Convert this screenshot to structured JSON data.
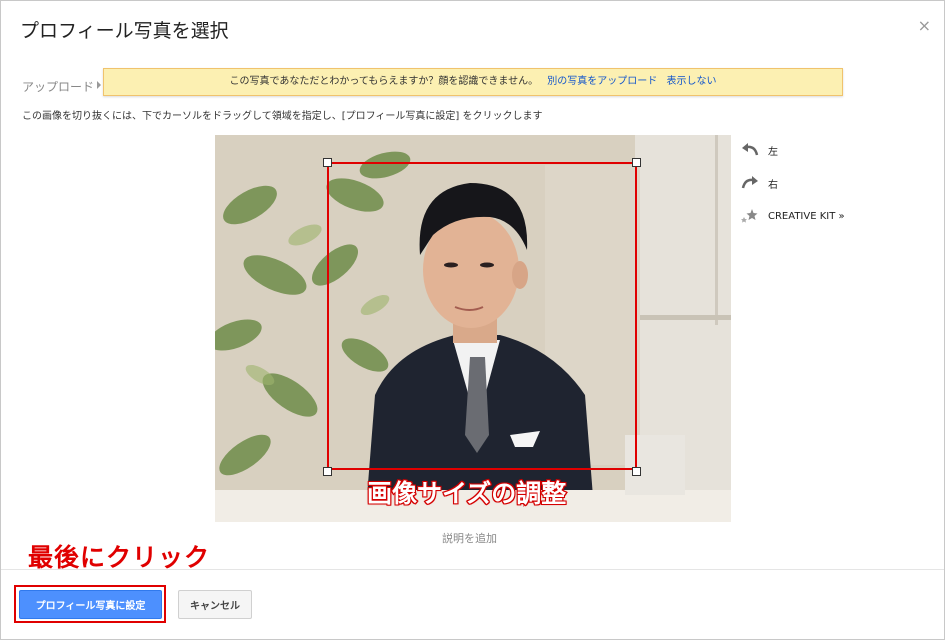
{
  "dialog": {
    "title": "プロフィール写真を選択",
    "close_glyph": "×"
  },
  "breadcrumb": {
    "label": "アップロード"
  },
  "notice": {
    "message": "この写真であなただとわかってもらえますか？顔を認識できません。",
    "link_upload_other": "別の写真をアップロード",
    "link_hide": "表示しない"
  },
  "instructions": "この画像を切り抜くには、下でカーソルをドラッグして領域を指定し、[プロフィール写真に設定] をクリックします",
  "rotate": {
    "left_label": "左",
    "right_label": "右",
    "creative_kit_label": "CREATIVE KIT »"
  },
  "photo": {
    "caption_placeholder": "説明を追加"
  },
  "annotations": {
    "crop_note": "画像サイズの調整",
    "final_note": "最後にクリック",
    "color": "#e00000"
  },
  "footer": {
    "primary_label": "プロフィール写真に設定",
    "cancel_label": "キャンセル"
  },
  "colors": {
    "primary_button": "#4d90fe",
    "notice_bg": "#fcf0b2",
    "link": "#1155cc"
  }
}
